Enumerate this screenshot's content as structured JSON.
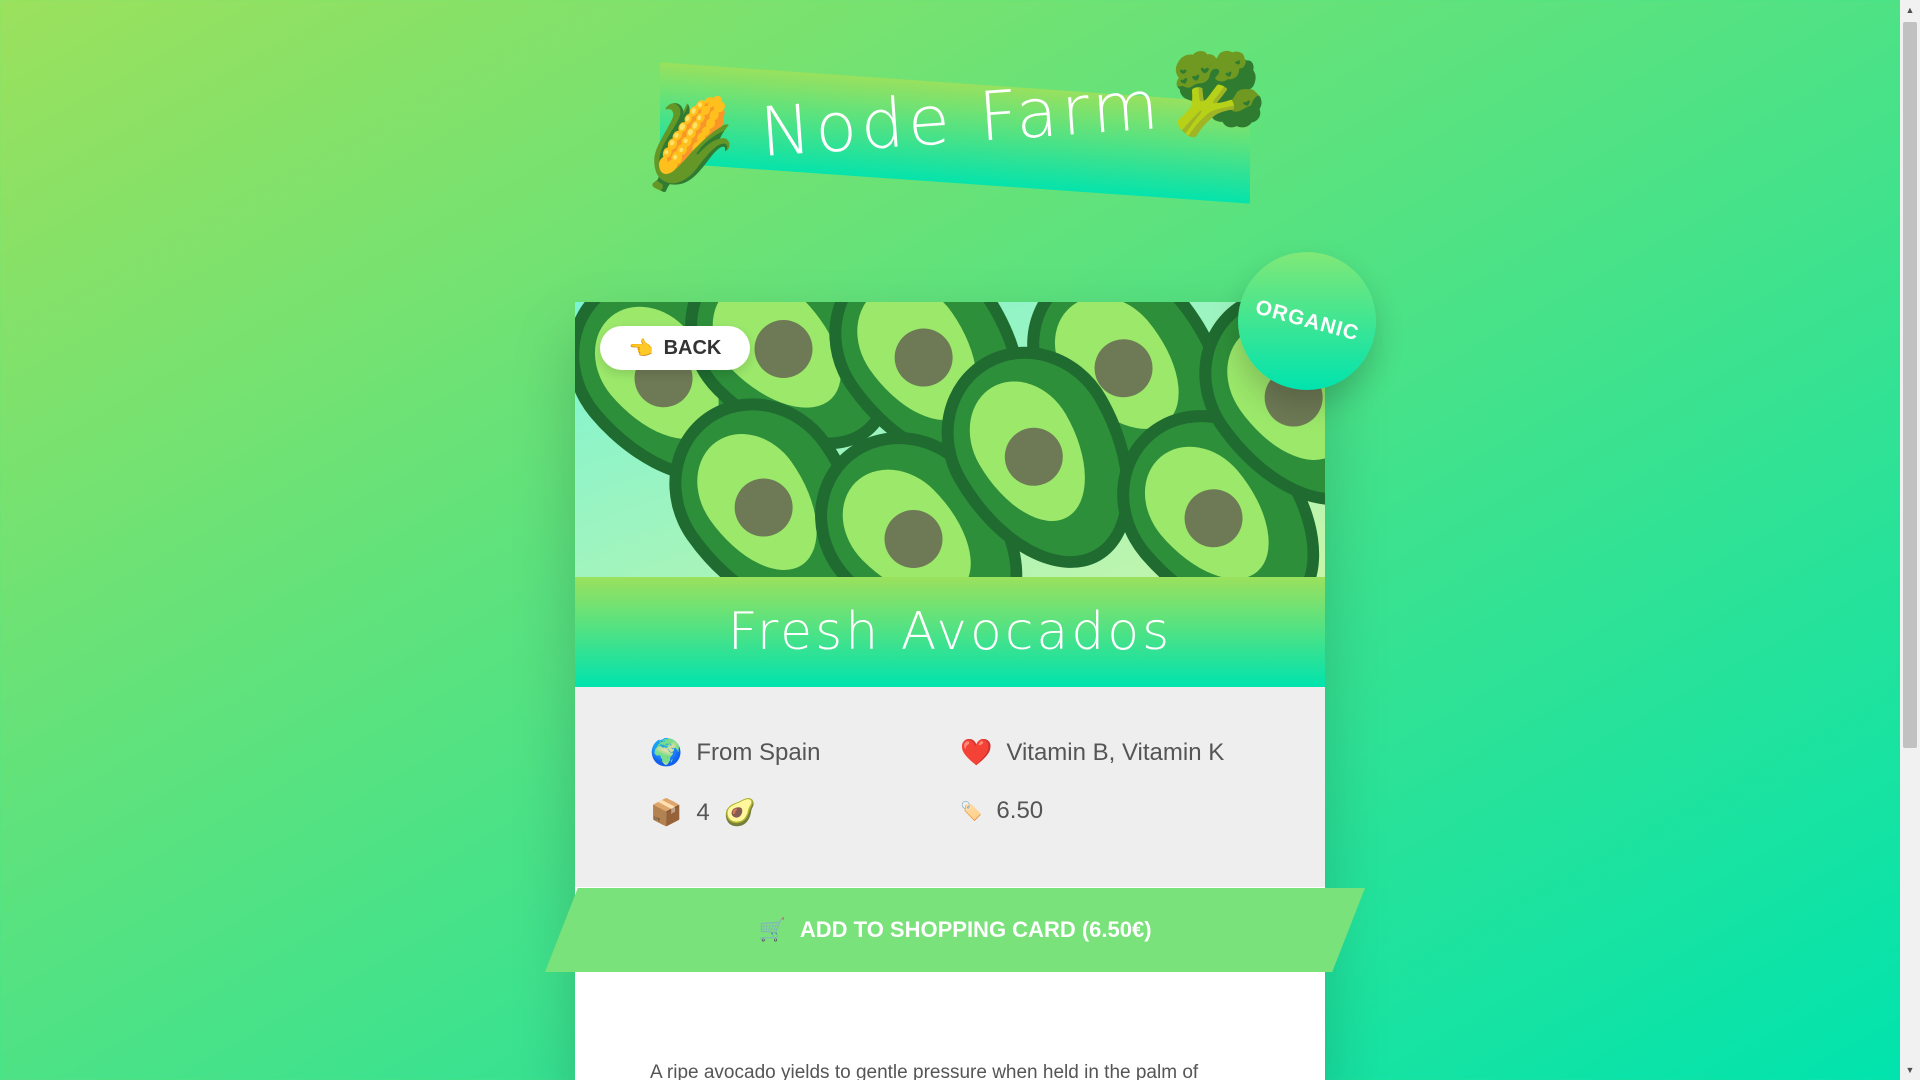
{
  "header": {
    "logo_text": "Node Farm",
    "left_icon": "corn-icon",
    "left_emoji": "🌽",
    "right_icon": "broccoli-icon",
    "right_emoji": "🥦"
  },
  "product": {
    "back_label": "BACK",
    "back_emoji": "👈",
    "badge": "ORGANIC",
    "name": "Fresh Avocados",
    "origin": "From Spain",
    "origin_emoji": "🌍",
    "nutrients": "Vitamin B, Vitamin K",
    "nutrients_emoji": "❤️",
    "quantity": "4",
    "quantity_emoji": "📦",
    "product_emoji": "🥑",
    "price": "6.50",
    "price_emoji": "🏷️",
    "cart_label": "ADD TO SHOPPING CARD (6.50€)",
    "cart_emoji": "🛒",
    "description": "A ripe avocado yields to gentle pressure when held in the palm of"
  },
  "colors": {
    "bg_start": "#9be15d",
    "bg_end": "#00e3ae",
    "button": "#79e27a"
  }
}
